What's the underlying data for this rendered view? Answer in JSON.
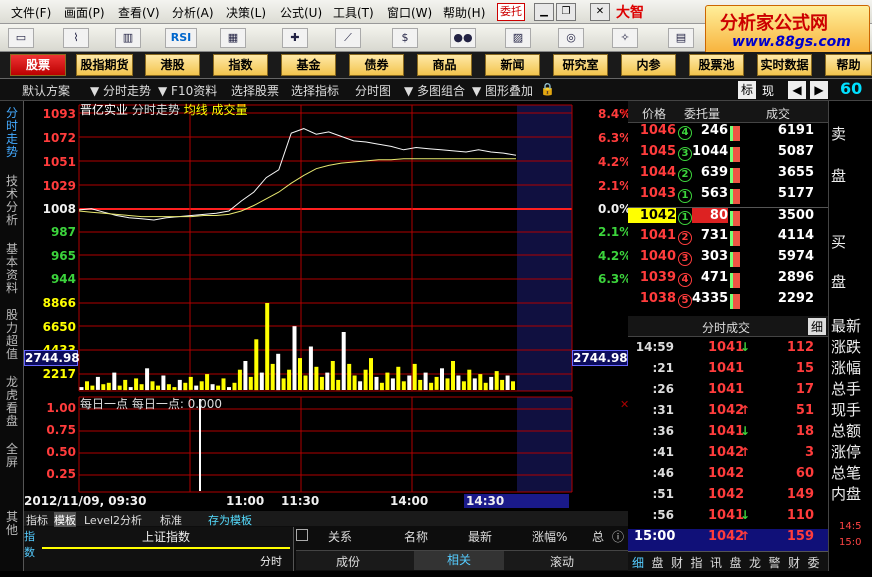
{
  "menubar": {
    "items": [
      "文件(F)",
      "画面(P)",
      "查看(V)",
      "分析(A)",
      "决策(L)",
      "公式(U)",
      "工具(T)",
      "窗口(W)",
      "帮助(H)"
    ],
    "weituo": "委托",
    "brand": "大智",
    "watermark": {
      "line1": "分析家公式网",
      "line2": "www.88gs.com"
    }
  },
  "toolbar": {
    "rsi_label": "RSI"
  },
  "navbar": {
    "items": [
      "股票",
      "股指期货",
      "港股",
      "指数",
      "基金",
      "债券",
      "商品",
      "新闻",
      "研究室",
      "内参",
      "股票池",
      "实时数据",
      "帮助"
    ]
  },
  "subbar": {
    "items": [
      "默认方案",
      "▼ 分时走势",
      "▼ F10资料",
      "选择股票",
      "选择指标",
      "分时图",
      "▼ 多图组合",
      "▼ 图形叠加"
    ],
    "right_tabs": [
      "标",
      "现"
    ],
    "big_number": "60"
  },
  "left_tabs": [
    "分时走势",
    "技术分析",
    "基本资料",
    "股力超值",
    "龙虎看盘",
    "全屏",
    "其他"
  ],
  "chart": {
    "header_labels": [
      "晋亿实业",
      "分时走势",
      "均线",
      "成交量"
    ],
    "price_axis": [
      "1093",
      "1072",
      "1051",
      "1029",
      "1008",
      "987",
      "965",
      "944"
    ],
    "pct_axis": [
      "8.4%",
      "6.3%",
      "4.2%",
      "2.1%",
      "0.0%",
      "2.1%",
      "4.2%",
      "6.3%"
    ],
    "volume_axis": [
      "8866",
      "6650",
      "4433",
      "2217"
    ],
    "volume_box": "2744.98",
    "volume_box_right": "2744.98",
    "indicator_header": "每日一点  每日一点: 0.000",
    "indicator_axis": [
      "1.00",
      "0.75",
      "0.50",
      "0.25"
    ],
    "date_label": "2012/11/09, 09:30",
    "time_labels": [
      "11:00",
      "11:30",
      "14:00",
      "14:30"
    ]
  },
  "chart_data": {
    "type": "line",
    "title": "晋亿实业 分时走势",
    "series": [
      {
        "name": "分时走势",
        "values": [
          1006,
          1007,
          1004,
          1001,
          999,
          998,
          997,
          999,
          1000,
          1001,
          1002,
          1003,
          1005,
          1014,
          1022,
          1035,
          1042,
          1075,
          1079,
          1074,
          1076,
          1072,
          1068,
          1067,
          1065,
          1063,
          1060,
          1062,
          1061,
          1060,
          1059,
          1058,
          1060,
          1058,
          1057,
          1055
        ]
      },
      {
        "name": "均线",
        "values": [
          1005,
          1004,
          1003,
          1002,
          1001,
          1000,
          1000,
          1000,
          1000,
          1000,
          1001,
          1001,
          1002,
          1005,
          1010,
          1016,
          1022,
          1030,
          1037,
          1043,
          1046,
          1048,
          1049,
          1050,
          1051,
          1051,
          1052,
          1052,
          1052,
          1052,
          1052,
          1052,
          1052,
          1052,
          1052,
          1052
        ]
      }
    ],
    "ylim": [
      944,
      1093
    ],
    "volume_ylim": [
      0,
      8866
    ]
  },
  "indicator_tabs": [
    "指标",
    "模板",
    "Level2分析",
    "标准",
    "存为模板"
  ],
  "bottom_left": {
    "index_label": "上证指数",
    "chart_label": "分时"
  },
  "bottom_table": {
    "headers": [
      "关系",
      "名称",
      "最新",
      "涨幅%",
      "总"
    ],
    "footer": [
      "成份",
      "相关",
      "滚动"
    ]
  },
  "orderbook": {
    "headers": [
      "价格",
      "委托量",
      "成交"
    ],
    "rows": [
      {
        "price": "1046",
        "code": "4",
        "vol": "246",
        "deal": "6191"
      },
      {
        "price": "1045",
        "code": "3",
        "vol": "1044",
        "deal": "5087"
      },
      {
        "price": "1044",
        "code": "2",
        "vol": "639",
        "deal": "3655"
      },
      {
        "price": "1043",
        "code": "1",
        "vol": "563",
        "deal": "5177"
      },
      {
        "price": "1042",
        "code": "1",
        "vol": "80",
        "deal": "3500"
      },
      {
        "price": "1041",
        "code": "2",
        "vol": "731",
        "deal": "4114"
      },
      {
        "price": "1040",
        "code": "3",
        "vol": "303",
        "deal": "5974"
      },
      {
        "price": "1039",
        "code": "4",
        "vol": "471",
        "deal": "2896"
      },
      {
        "price": "1038",
        "code": "5",
        "vol": "4335",
        "deal": "2292"
      }
    ]
  },
  "ticks": {
    "header": "分时成交",
    "side_btn": "细",
    "rows": [
      {
        "time": "14:59",
        "price": "1041",
        "arrow": "down",
        "vol": "112"
      },
      {
        "time": ":21",
        "price": "1041",
        "arrow": "",
        "vol": "15"
      },
      {
        "time": ":26",
        "price": "1041",
        "arrow": "",
        "vol": "17"
      },
      {
        "time": ":31",
        "price": "1042",
        "arrow": "up",
        "vol": "51"
      },
      {
        "time": ":36",
        "price": "1041",
        "arrow": "down",
        "vol": "18"
      },
      {
        "time": ":41",
        "price": "1042",
        "arrow": "up",
        "vol": "3"
      },
      {
        "time": ":46",
        "price": "1042",
        "arrow": "",
        "vol": "60"
      },
      {
        "time": ":51",
        "price": "1042",
        "arrow": "",
        "vol": "149"
      },
      {
        "time": ":56",
        "price": "1041",
        "arrow": "down",
        "vol": "110"
      }
    ],
    "last": {
      "time": "15:00",
      "price": "1042",
      "arrow": "up",
      "vol": "159"
    }
  },
  "right_tabs": [
    "卖",
    "盘",
    "买",
    "盘",
    "最新",
    "涨跌",
    "涨幅",
    "总手",
    "现手",
    "总额",
    "涨停",
    "总笔",
    "内盘"
  ],
  "bottom_right_tabs": [
    "细",
    "盘",
    "财",
    "指",
    "讯",
    "盘",
    "龙",
    "警",
    "财",
    "委"
  ],
  "right_bottom_numbers": [
    "14:5",
    "15:0"
  ],
  "colors": {
    "up": "#ff3c3c",
    "down": "#3cd43c",
    "grid": "#b00000"
  }
}
